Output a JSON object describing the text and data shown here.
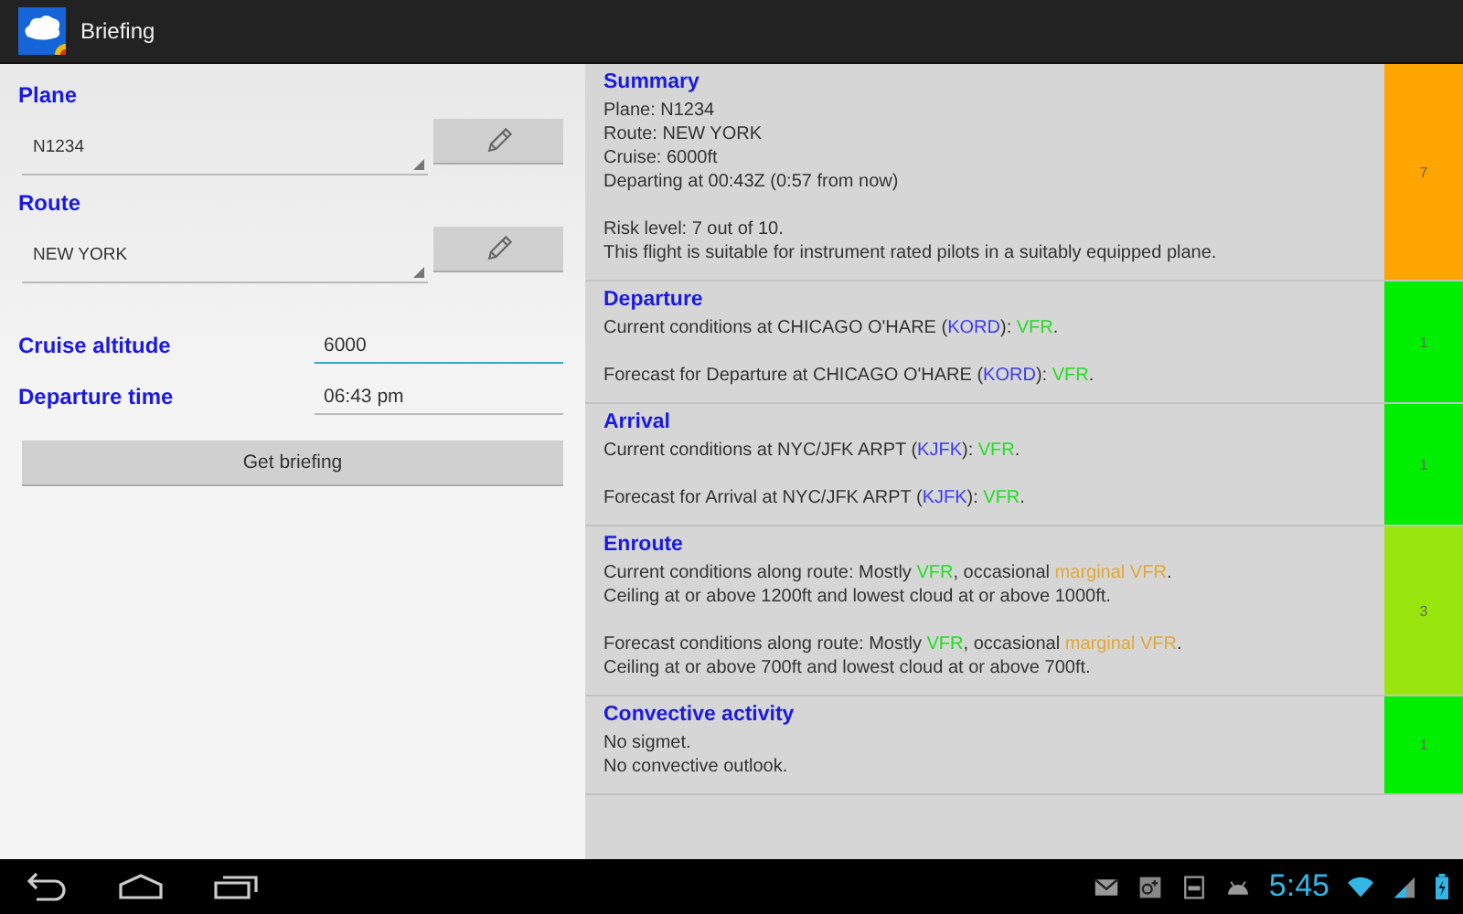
{
  "app_bar": {
    "title": "Briefing"
  },
  "form": {
    "plane": {
      "label": "Plane",
      "value": "N1234"
    },
    "route": {
      "label": "Route",
      "value": "NEW YORK"
    },
    "fields": [
      {
        "label": "Cruise altitude",
        "value": "6000",
        "focused": true
      },
      {
        "label": "Departure time",
        "value": "06:43 pm",
        "focused": false
      }
    ],
    "button": "Get briefing"
  },
  "sections": [
    {
      "title": "Summary",
      "score": "7",
      "color": "#ffa500",
      "paragraphs": [
        [
          [
            {
              "text": "Plane: N1234",
              "kind": "plain"
            }
          ],
          [
            {
              "text": "Route: NEW YORK",
              "kind": "plain"
            }
          ],
          [
            {
              "text": "Cruise: 6000ft",
              "kind": "plain"
            }
          ],
          [
            {
              "text": "Departing at 00:43Z (0:57 from now)",
              "kind": "plain"
            }
          ]
        ],
        [
          [
            {
              "text": "Risk level: 7 out of 10.",
              "kind": "plain"
            }
          ],
          [
            {
              "text": "This flight is suitable for instrument rated pilots in a suitably equipped plane.",
              "kind": "plain"
            }
          ]
        ]
      ]
    },
    {
      "title": "Departure",
      "score": "1",
      "color": "#00ee00",
      "paragraphs": [
        [
          [
            {
              "text": "Current conditions at CHICAGO O'HARE (",
              "kind": "plain"
            },
            {
              "text": "KORD",
              "kind": "station"
            },
            {
              "text": "): ",
              "kind": "plain"
            },
            {
              "text": "VFR",
              "kind": "vfr"
            },
            {
              "text": ".",
              "kind": "plain"
            }
          ]
        ],
        [
          [
            {
              "text": "Forecast for Departure at CHICAGO O'HARE (",
              "kind": "plain"
            },
            {
              "text": "KORD",
              "kind": "station"
            },
            {
              "text": "): ",
              "kind": "plain"
            },
            {
              "text": "VFR",
              "kind": "vfr"
            },
            {
              "text": ".",
              "kind": "plain"
            }
          ]
        ]
      ]
    },
    {
      "title": "Arrival",
      "score": "1",
      "color": "#00ee00",
      "paragraphs": [
        [
          [
            {
              "text": "Current conditions at NYC/JFK ARPT (",
              "kind": "plain"
            },
            {
              "text": "KJFK",
              "kind": "station"
            },
            {
              "text": "): ",
              "kind": "plain"
            },
            {
              "text": "VFR",
              "kind": "vfr"
            },
            {
              "text": ".",
              "kind": "plain"
            }
          ]
        ],
        [
          [
            {
              "text": "Forecast for Arrival at NYC/JFK ARPT (",
              "kind": "plain"
            },
            {
              "text": "KJFK",
              "kind": "station"
            },
            {
              "text": "): ",
              "kind": "plain"
            },
            {
              "text": "VFR",
              "kind": "vfr"
            },
            {
              "text": ".",
              "kind": "plain"
            }
          ]
        ]
      ]
    },
    {
      "title": "Enroute",
      "score": "3",
      "color": "#99e60f",
      "paragraphs": [
        [
          [
            {
              "text": "Current conditions along route: Mostly ",
              "kind": "plain"
            },
            {
              "text": "VFR",
              "kind": "vfr"
            },
            {
              "text": ", occasional ",
              "kind": "plain"
            },
            {
              "text": "marginal VFR",
              "kind": "mvfr"
            },
            {
              "text": ".",
              "kind": "plain"
            }
          ],
          [
            {
              "text": "Ceiling at or above 1200ft and lowest cloud at or above 1000ft.",
              "kind": "plain"
            }
          ]
        ],
        [
          [
            {
              "text": "Forecast conditions along route: Mostly ",
              "kind": "plain"
            },
            {
              "text": "VFR",
              "kind": "vfr"
            },
            {
              "text": ", occasional ",
              "kind": "plain"
            },
            {
              "text": "marginal VFR",
              "kind": "mvfr"
            },
            {
              "text": ".",
              "kind": "plain"
            }
          ],
          [
            {
              "text": "Ceiling at or above 700ft and lowest cloud at or above 700ft.",
              "kind": "plain"
            }
          ]
        ]
      ]
    },
    {
      "title": "Convective activity",
      "score": "1",
      "color": "#00ee00",
      "paragraphs": [
        [
          [
            {
              "text": "No sigmet.",
              "kind": "plain"
            }
          ],
          [
            {
              "text": "No convective outlook.",
              "kind": "plain"
            }
          ]
        ]
      ]
    }
  ],
  "status_bar": {
    "time": "5:45"
  }
}
